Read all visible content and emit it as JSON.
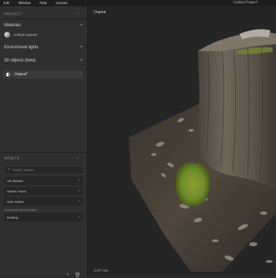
{
  "menubar": {
    "items": [
      "Edit",
      "Window",
      "Help",
      "License"
    ],
    "document_title": "Untitled Project*"
  },
  "sidebar": {
    "project_header": "PROJECT",
    "materials_label": "Materials",
    "material_item": "Untitled material*",
    "environment_label": "Environment lights",
    "objects_label": "3D objects (beta)",
    "object_item": "Original*",
    "assets_header": "ASSETS",
    "search_placeholder": "Search assets",
    "asset_rows": [
      "All Libraries",
      "Starter Assets",
      "User Assets"
    ],
    "downloaded_label": "Connected Cloud folder",
    "desktop_row": "Desktop"
  },
  "viewport": {
    "object_label": "Original",
    "face_count": "2,477 tris"
  },
  "icons": {
    "add": "plus-icon",
    "expand": "chevron-right-icon",
    "search": "search-icon",
    "delete": "trash-icon"
  },
  "colors": {
    "panel_bg": "#2f2f2f",
    "viewport_bg": "#252525",
    "moss": "#6e8a2a"
  }
}
